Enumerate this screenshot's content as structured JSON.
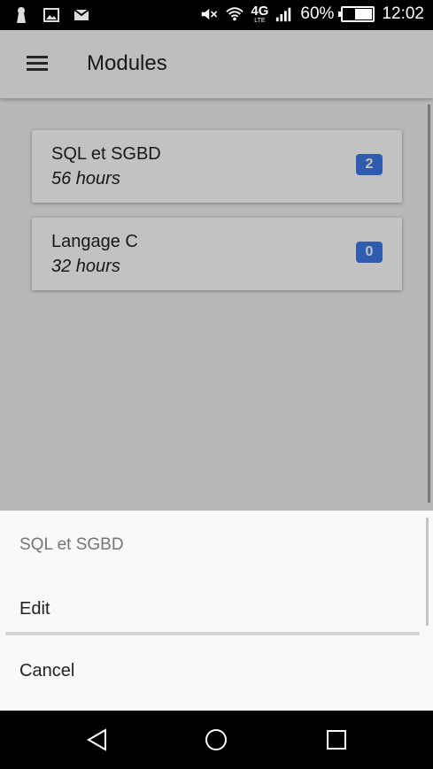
{
  "status_bar": {
    "network_label": "4G",
    "network_sub": "LTE",
    "battery": "60%",
    "battery_level": 0.6,
    "time": "12:02",
    "icons": [
      "keyhole-icon",
      "image-icon",
      "mail-icon",
      "mute-icon",
      "wifi-icon",
      "signal-icon",
      "battery-icon"
    ]
  },
  "app_bar": {
    "title": "Modules",
    "menu_icon": "menu-icon"
  },
  "modules": [
    {
      "name": "SQL et SGBD",
      "hours": "56 hours",
      "count": "2"
    },
    {
      "name": "Langage C",
      "hours": "32 hours",
      "count": "0"
    }
  ],
  "action_sheet": {
    "title": "SQL et SGBD",
    "edit_label": "Edit",
    "cancel_label": "Cancel"
  },
  "nav_bar": {
    "icons": [
      "back-icon",
      "home-icon",
      "recents-icon"
    ]
  },
  "colors": {
    "badge": "#3f7ae6",
    "sheet_bg": "#f9f9f9",
    "app_bg": "#f2f2f2"
  }
}
